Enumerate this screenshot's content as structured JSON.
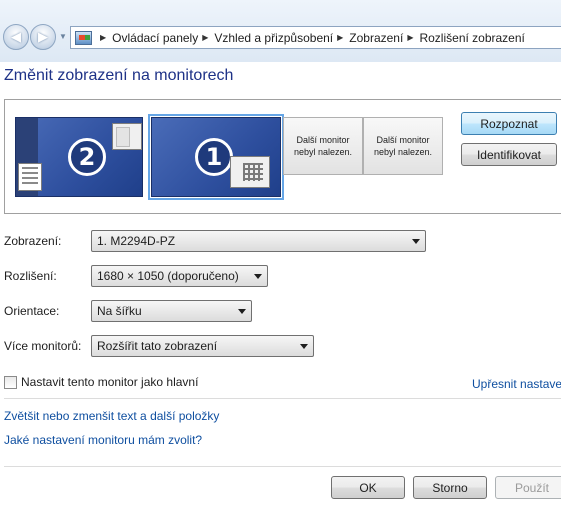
{
  "window": {
    "breadcrumb": [
      "Ovládací panely",
      "Vzhled a přizpůsobení",
      "Zobrazení",
      "Rozlišení zobrazení"
    ],
    "page_title": "Změnit zobrazení na monitorech"
  },
  "monitors": {
    "monitor_2_number": "2",
    "monitor_1_number": "1",
    "not_found_1": "Další monitor nebyl nalezen.",
    "not_found_2": "Další monitor nebyl nalezen.",
    "detect_button": "Rozpoznat",
    "identify_button": "Identifikovat"
  },
  "form": {
    "display_label": "Zobrazení:",
    "display_value": "1. M2294D-PZ",
    "resolution_label": "Rozlišení:",
    "resolution_value": "1680 × 1050 (doporučeno)",
    "orientation_label": "Orientace:",
    "orientation_value": "Na šířku",
    "multi_label": "Více monitorů:",
    "multi_value": "Rozšířit tato zobrazení",
    "main_monitor_checkbox": "Nastavit tento monitor jako hlavní",
    "main_monitor_checked": false,
    "advanced_link": "Upřesnit nastavení"
  },
  "links": {
    "text_size": "Zvětšit nebo zmenšit text a další položky",
    "help": "Jaké nastavení monitoru mám zvolit?"
  },
  "footer": {
    "ok": "OK",
    "cancel": "Storno",
    "apply": "Použít"
  },
  "colors": {
    "title": "#1e3287",
    "link": "#0f4fa0",
    "monitor_blue": "#2e4f9e"
  }
}
